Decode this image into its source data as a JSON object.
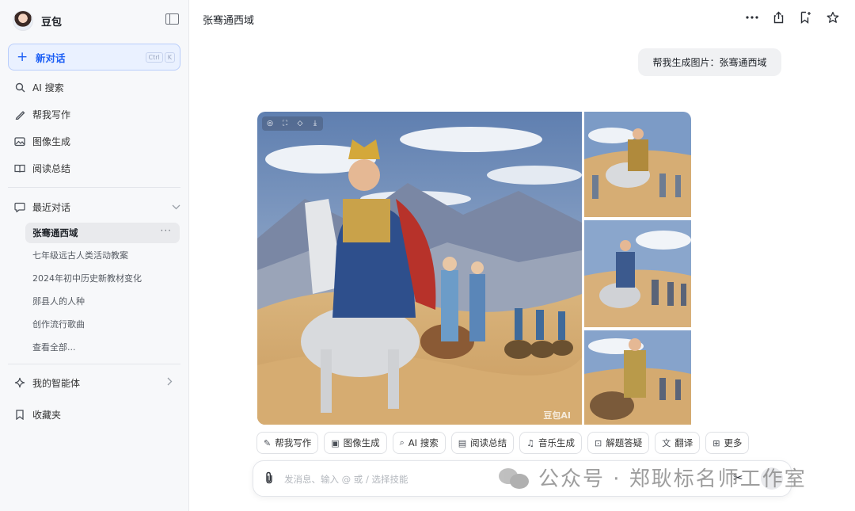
{
  "sidebar": {
    "brand": "豆包",
    "new_chat": {
      "label": "新对话",
      "shortcut": [
        "Ctrl",
        "K"
      ]
    },
    "nav": {
      "ai_search": "AI 搜索",
      "write": "帮我写作",
      "image_gen": "图像生成",
      "read_summary": "阅读总结"
    },
    "recent": {
      "title": "最近对话",
      "active": "张骞通西域",
      "items": [
        "七年级远古人类活动教案",
        "2024年初中历史新教材变化",
        "郧县人的人种",
        "创作流行歌曲"
      ],
      "see_all": "查看全部..."
    },
    "agents": "我的智能体",
    "favorites": "收藏夹"
  },
  "main": {
    "title": "张骞通西域",
    "user_message": "帮我生成图片：张骞通西域",
    "image_watermark": "豆包AI",
    "chips": [
      "帮我写作",
      "图像生成",
      "AI 搜索",
      "阅读总结",
      "音乐生成",
      "解题答疑",
      "翻译",
      "更多"
    ],
    "input_placeholder": "发消息、输入 @ 或 / 选择技能"
  },
  "overlay_watermark": "公众号 · 郑耿标名师工作室",
  "colors": {
    "accent": "#1d5ff5",
    "sidebar_bg": "#f7f8fa",
    "bubble_bg": "#f0f1f3"
  }
}
